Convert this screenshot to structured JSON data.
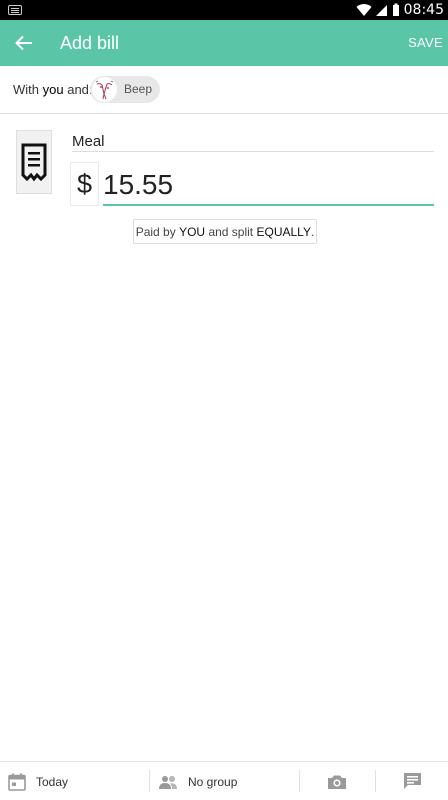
{
  "status_bar": {
    "time": "08:45"
  },
  "app_bar": {
    "title": "Add bill",
    "save_label": "SAVE"
  },
  "with_row": {
    "prefix": "With",
    "you": "you",
    "suffix": "and:",
    "participant": {
      "name": "Beep"
    }
  },
  "bill": {
    "description_value": "Meal",
    "currency_symbol": "$",
    "amount_value": "15.55"
  },
  "split": {
    "paid_by": "Paid by",
    "payer": "YOU",
    "and_split": "and split",
    "mode": "EQUALLY",
    "period": "."
  },
  "bottom_bar": {
    "date_label": "Today",
    "group_label": "No group"
  },
  "colors": {
    "accent": "#5bc5a7"
  }
}
